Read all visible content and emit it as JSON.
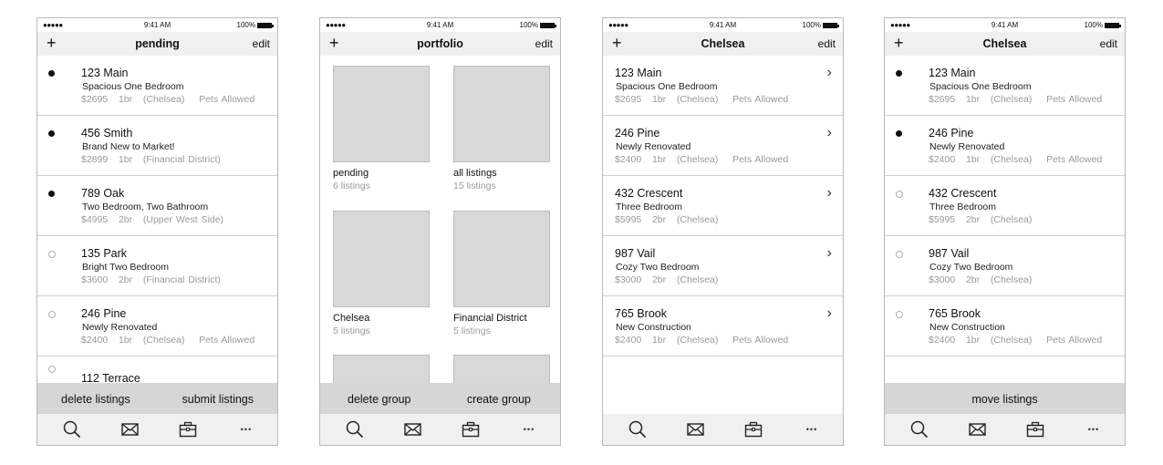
{
  "status": {
    "dots": "●●●●● ",
    "time": "9:41 AM",
    "battery": "100%"
  },
  "phones": [
    {
      "nav": {
        "add": "+",
        "title": "pending",
        "edit": "edit"
      },
      "rows": [
        {
          "addr": "123 Main",
          "desc": "Spacious One Bedroom",
          "meta": "$2695   1br   (Chelsea)    Pets Allowed",
          "selected": true
        },
        {
          "addr": "456 Smith",
          "desc": "Brand New to Market!",
          "meta": "$2899   1br   (Financial District)",
          "selected": true
        },
        {
          "addr": "789 Oak",
          "desc": "Two Bedroom, Two Bathroom",
          "meta": "$4995   2br   (Upper West Side)",
          "selected": true
        },
        {
          "addr": "135 Park",
          "desc": "Bright Two Bedroom",
          "meta": "$3600   2br   (Financial District)",
          "selected": false
        },
        {
          "addr": "246 Pine",
          "desc": "Newly Renovated",
          "meta": "$2400   1br   (Chelsea)    Pets Allowed",
          "selected": false
        },
        {
          "addr": "112 Terrace",
          "desc": "",
          "meta": "",
          "selected": false
        }
      ],
      "actions": {
        "left": "delete listings",
        "right": "submit listings"
      }
    },
    {
      "nav": {
        "add": "+",
        "title": "portfolio",
        "edit": "edit"
      },
      "groups": [
        {
          "name": "pending",
          "count": "6 listings"
        },
        {
          "name": "all listings",
          "count": "15 listings"
        },
        {
          "name": "Chelsea",
          "count": "5 listings"
        },
        {
          "name": "Financial District",
          "count": "5 listings"
        }
      ],
      "actions": {
        "left": "delete group",
        "right": "create group"
      }
    },
    {
      "nav": {
        "add": "+",
        "title": "Chelsea",
        "edit": "edit"
      },
      "rows": [
        {
          "addr": "123 Main",
          "desc": "Spacious One Bedroom",
          "meta": "$2695   1br   (Chelsea)    Pets Allowed"
        },
        {
          "addr": "246 Pine",
          "desc": "Newly Renovated",
          "meta": "$2400   1br   (Chelsea)    Pets Allowed"
        },
        {
          "addr": "432 Crescent",
          "desc": "Three Bedroom",
          "meta": "$5995   2br   (Chelsea)"
        },
        {
          "addr": "987 Vail",
          "desc": "Cozy Two Bedroom",
          "meta": "$3000   2br   (Chelsea)"
        },
        {
          "addr": "765 Brook",
          "desc": "New Construction",
          "meta": "$2400   1br   (Chelsea)    Pets Allowed"
        }
      ]
    },
    {
      "nav": {
        "add": "+",
        "title": "Chelsea",
        "edit": "edit"
      },
      "rows": [
        {
          "addr": "123 Main",
          "desc": "Spacious One Bedroom",
          "meta": "$2695   1br   (Chelsea)    Pets Allowed",
          "selected": true
        },
        {
          "addr": "246 Pine",
          "desc": "Newly Renovated",
          "meta": "$2400   1br   (Chelsea)    Pets Allowed",
          "selected": true
        },
        {
          "addr": "432 Crescent",
          "desc": "Three Bedroom",
          "meta": "$5995   2br   (Chelsea)",
          "selected": false
        },
        {
          "addr": "987 Vail",
          "desc": "Cozy Two Bedroom",
          "meta": "$3000   2br   (Chelsea)",
          "selected": false
        },
        {
          "addr": "765 Brook",
          "desc": "New Construction",
          "meta": "$2400   1br   (Chelsea)    Pets Allowed",
          "selected": false
        }
      ],
      "actions": {
        "center": "move listings"
      }
    }
  ],
  "tabbar": [
    "search-icon",
    "mail-icon",
    "briefcase-icon",
    "more-icon"
  ],
  "chevron": "›",
  "more": "•••"
}
